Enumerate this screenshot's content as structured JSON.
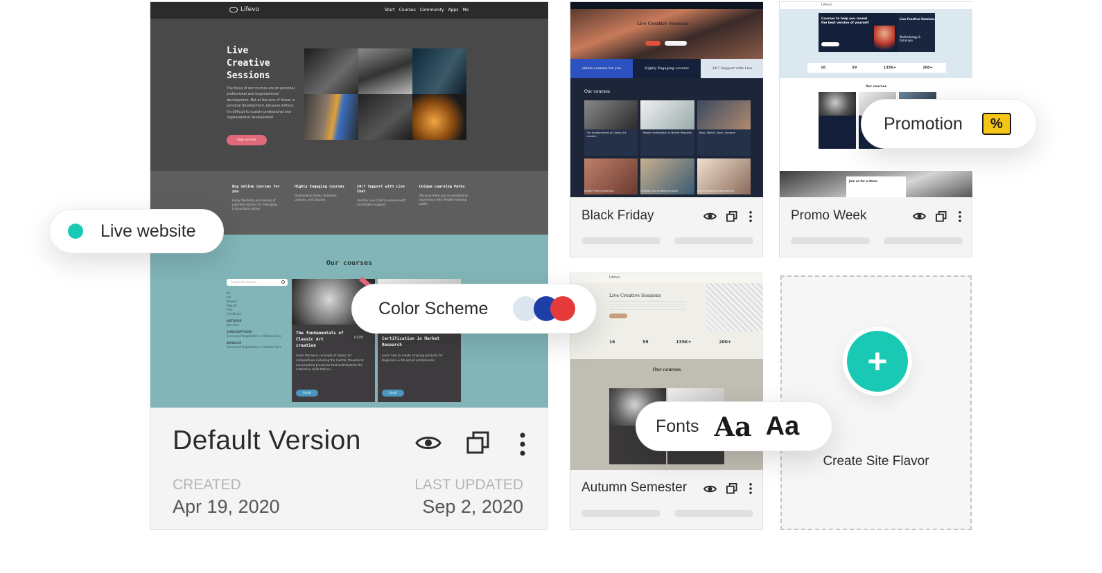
{
  "default_card": {
    "title": "Default Version",
    "created_label": "CREATED",
    "created_date": "Apr 19, 2020",
    "updated_label": "LAST UPDATED",
    "updated_date": "Sep 2, 2020",
    "preview": {
      "brand": "Lifevo",
      "nav": [
        "Start",
        "Courses",
        "Community",
        "Apps",
        "Me"
      ],
      "hero_title_lines": [
        "Live",
        "Creative",
        "Sessions"
      ],
      "hero_text": "The focus of our courses are on personal, professional and organizational development. But at the core of these, is personal development, because without, it's difficult to sustain professional and organizational development.",
      "cta": "Sign up now",
      "features": [
        {
          "title": "Buy online courses for you",
          "text": "Enjoy flexibility and variety of payment options for managing transactions online."
        },
        {
          "title": "Highly Engaging courses",
          "text": "Outstanding Video, Activities, Lessons, and Quizzes."
        },
        {
          "title": "24/7 Support with Live Chat",
          "text": "Use the Live Chat to receive swift and helpful support."
        },
        {
          "title": "Unique Learning Paths",
          "text": "We guarantee you an exceptional experience with flexible learning paths."
        }
      ],
      "courses_heading": "Our courses",
      "search_placeholder": "Search for courses",
      "filters": [
        "All",
        "Art",
        "Newest",
        "Popular",
        "Free",
        "Certificate"
      ],
      "authors_label": "AUTHORS",
      "author": "John Doe",
      "subscriptions_label": "SUBSCRIPTIONS",
      "subscription": "Successful Negotiations: A MasterClass",
      "bundles_label": "BUNDLES",
      "bundle": "Successful Negotiations: A MasterClass",
      "course1_title": "The fundamentals of Classic Art creation",
      "course1_price": "€109",
      "course1_text": "Learn the basic concepts of classic art compositions including the mental, theoretical, and practical processes that contribute to the instinctive skills that en...",
      "course2_title": "Certification in Market Research",
      "course2_text": "Learn how to create amazing products for Beginners & Advanced professionals",
      "enroll": "Enroll"
    }
  },
  "black_friday": {
    "title": "Black Friday",
    "hero_title": "Live Creative Sessions",
    "strip": [
      "online courses for you",
      "Highly Engaging courses",
      "24/7 Support with Live"
    ],
    "courses_heading": "Our courses",
    "items": [
      "The fundamentals of Classic Art creation",
      "Master Certification in Market Research",
      "Read, Watch, Learn, Improve",
      "Design Theory Essentials",
      "Develop your professional skills",
      "Human Resources Management"
    ]
  },
  "promo_week": {
    "title": "Promo Week",
    "brand": "Lifevo",
    "hero_text": "Courses to help you reveal the best version of yourself",
    "side_title": "Live Creative Sessions",
    "side_sub": "Methodology & Rationale",
    "stats": [
      "16",
      "59",
      "135K+",
      "200+"
    ],
    "courses_heading": "Our courses",
    "demo": "Join us for a demo"
  },
  "autumn": {
    "title": "Autumn Semester",
    "brand": "Lifevo",
    "hero_title": "Live Creative Sessions",
    "stats": [
      "16",
      "59",
      "135K+",
      "200+"
    ],
    "courses_heading": "Our courses"
  },
  "create": {
    "label": "Create Site Flavor",
    "plus": "+"
  },
  "badges": {
    "live": "Live website",
    "color_scheme": "Color Scheme",
    "promotion": "Promotion",
    "fonts": "Fonts",
    "font_sample_serif": "Aa",
    "font_sample_sans": "Aa",
    "promo_glyph": "%"
  },
  "colors": {
    "teal": "#19c9b4",
    "promo_yellow": "#f5c518",
    "scheme": [
      "#dce6ee",
      "#1f3fa8",
      "#e53a3a"
    ]
  },
  "icons": [
    "eye-icon",
    "duplicate-icon",
    "more-vertical-icon",
    "plus-icon",
    "percent-ticket-icon"
  ]
}
